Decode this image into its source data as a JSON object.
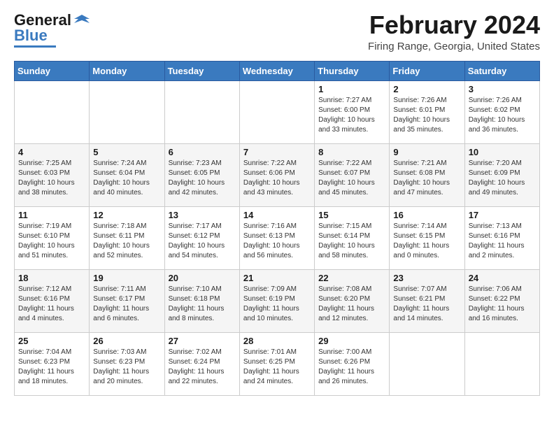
{
  "header": {
    "logo_general": "General",
    "logo_blue": "Blue",
    "month_title": "February 2024",
    "location": "Firing Range, Georgia, United States"
  },
  "days_of_week": [
    "Sunday",
    "Monday",
    "Tuesday",
    "Wednesday",
    "Thursday",
    "Friday",
    "Saturday"
  ],
  "weeks": [
    [
      {
        "day": "",
        "info": ""
      },
      {
        "day": "",
        "info": ""
      },
      {
        "day": "",
        "info": ""
      },
      {
        "day": "",
        "info": ""
      },
      {
        "day": "1",
        "info": "Sunrise: 7:27 AM\nSunset: 6:00 PM\nDaylight: 10 hours\nand 33 minutes."
      },
      {
        "day": "2",
        "info": "Sunrise: 7:26 AM\nSunset: 6:01 PM\nDaylight: 10 hours\nand 35 minutes."
      },
      {
        "day": "3",
        "info": "Sunrise: 7:26 AM\nSunset: 6:02 PM\nDaylight: 10 hours\nand 36 minutes."
      }
    ],
    [
      {
        "day": "4",
        "info": "Sunrise: 7:25 AM\nSunset: 6:03 PM\nDaylight: 10 hours\nand 38 minutes."
      },
      {
        "day": "5",
        "info": "Sunrise: 7:24 AM\nSunset: 6:04 PM\nDaylight: 10 hours\nand 40 minutes."
      },
      {
        "day": "6",
        "info": "Sunrise: 7:23 AM\nSunset: 6:05 PM\nDaylight: 10 hours\nand 42 minutes."
      },
      {
        "day": "7",
        "info": "Sunrise: 7:22 AM\nSunset: 6:06 PM\nDaylight: 10 hours\nand 43 minutes."
      },
      {
        "day": "8",
        "info": "Sunrise: 7:22 AM\nSunset: 6:07 PM\nDaylight: 10 hours\nand 45 minutes."
      },
      {
        "day": "9",
        "info": "Sunrise: 7:21 AM\nSunset: 6:08 PM\nDaylight: 10 hours\nand 47 minutes."
      },
      {
        "day": "10",
        "info": "Sunrise: 7:20 AM\nSunset: 6:09 PM\nDaylight: 10 hours\nand 49 minutes."
      }
    ],
    [
      {
        "day": "11",
        "info": "Sunrise: 7:19 AM\nSunset: 6:10 PM\nDaylight: 10 hours\nand 51 minutes."
      },
      {
        "day": "12",
        "info": "Sunrise: 7:18 AM\nSunset: 6:11 PM\nDaylight: 10 hours\nand 52 minutes."
      },
      {
        "day": "13",
        "info": "Sunrise: 7:17 AM\nSunset: 6:12 PM\nDaylight: 10 hours\nand 54 minutes."
      },
      {
        "day": "14",
        "info": "Sunrise: 7:16 AM\nSunset: 6:13 PM\nDaylight: 10 hours\nand 56 minutes."
      },
      {
        "day": "15",
        "info": "Sunrise: 7:15 AM\nSunset: 6:14 PM\nDaylight: 10 hours\nand 58 minutes."
      },
      {
        "day": "16",
        "info": "Sunrise: 7:14 AM\nSunset: 6:15 PM\nDaylight: 11 hours\nand 0 minutes."
      },
      {
        "day": "17",
        "info": "Sunrise: 7:13 AM\nSunset: 6:16 PM\nDaylight: 11 hours\nand 2 minutes."
      }
    ],
    [
      {
        "day": "18",
        "info": "Sunrise: 7:12 AM\nSunset: 6:16 PM\nDaylight: 11 hours\nand 4 minutes."
      },
      {
        "day": "19",
        "info": "Sunrise: 7:11 AM\nSunset: 6:17 PM\nDaylight: 11 hours\nand 6 minutes."
      },
      {
        "day": "20",
        "info": "Sunrise: 7:10 AM\nSunset: 6:18 PM\nDaylight: 11 hours\nand 8 minutes."
      },
      {
        "day": "21",
        "info": "Sunrise: 7:09 AM\nSunset: 6:19 PM\nDaylight: 11 hours\nand 10 minutes."
      },
      {
        "day": "22",
        "info": "Sunrise: 7:08 AM\nSunset: 6:20 PM\nDaylight: 11 hours\nand 12 minutes."
      },
      {
        "day": "23",
        "info": "Sunrise: 7:07 AM\nSunset: 6:21 PM\nDaylight: 11 hours\nand 14 minutes."
      },
      {
        "day": "24",
        "info": "Sunrise: 7:06 AM\nSunset: 6:22 PM\nDaylight: 11 hours\nand 16 minutes."
      }
    ],
    [
      {
        "day": "25",
        "info": "Sunrise: 7:04 AM\nSunset: 6:23 PM\nDaylight: 11 hours\nand 18 minutes."
      },
      {
        "day": "26",
        "info": "Sunrise: 7:03 AM\nSunset: 6:23 PM\nDaylight: 11 hours\nand 20 minutes."
      },
      {
        "day": "27",
        "info": "Sunrise: 7:02 AM\nSunset: 6:24 PM\nDaylight: 11 hours\nand 22 minutes."
      },
      {
        "day": "28",
        "info": "Sunrise: 7:01 AM\nSunset: 6:25 PM\nDaylight: 11 hours\nand 24 minutes."
      },
      {
        "day": "29",
        "info": "Sunrise: 7:00 AM\nSunset: 6:26 PM\nDaylight: 11 hours\nand 26 minutes."
      },
      {
        "day": "",
        "info": ""
      },
      {
        "day": "",
        "info": ""
      }
    ]
  ]
}
